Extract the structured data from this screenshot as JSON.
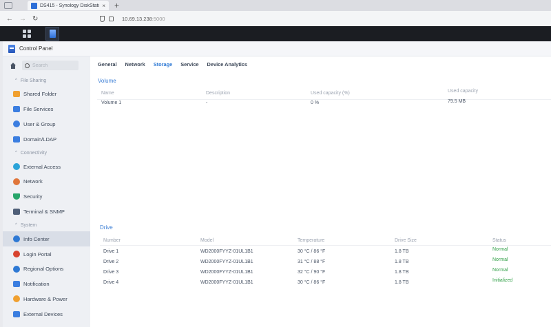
{
  "browser": {
    "tab_title": "DS415 - Synology DiskStation",
    "tab_close": "×",
    "new_tab": "+",
    "url_host": "10.69.13.238",
    "url_port": ":5000"
  },
  "window": {
    "title": "Control Panel"
  },
  "sidebar": {
    "search_placeholder": "Search",
    "groups": [
      {
        "label": "File Sharing",
        "items": [
          {
            "label": "Shared Folder",
            "icon": "folder-icon",
            "color": "#f0a030"
          },
          {
            "label": "File Services",
            "icon": "file-services-icon",
            "color": "#3b7ee0"
          },
          {
            "label": "User & Group",
            "icon": "users-icon",
            "color": "#3b7ee0"
          },
          {
            "label": "Domain/LDAP",
            "icon": "domain-icon",
            "color": "#3b7ee0"
          }
        ]
      },
      {
        "label": "Connectivity",
        "items": [
          {
            "label": "External Access",
            "icon": "external-access-icon",
            "color": "#2aa3d8"
          },
          {
            "label": "Network",
            "icon": "network-icon",
            "color": "#e0763b"
          },
          {
            "label": "Security",
            "icon": "security-icon",
            "color": "#27a56a"
          },
          {
            "label": "Terminal & SNMP",
            "icon": "terminal-icon",
            "color": "#4f5f78"
          }
        ]
      },
      {
        "label": "System",
        "items": [
          {
            "label": "Info Center",
            "icon": "info-icon",
            "color": "#2e79d4",
            "active": true
          },
          {
            "label": "Login Portal",
            "icon": "login-portal-icon",
            "color": "#d8432f"
          },
          {
            "label": "Regional Options",
            "icon": "globe-icon",
            "color": "#2e79d4"
          },
          {
            "label": "Notification",
            "icon": "notification-icon",
            "color": "#3b7ee0"
          },
          {
            "label": "Hardware & Power",
            "icon": "bulb-icon",
            "color": "#f0a030"
          },
          {
            "label": "External Devices",
            "icon": "external-devices-icon",
            "color": "#3b7ee0"
          }
        ]
      }
    ]
  },
  "tabs": [
    "General",
    "Network",
    "Storage",
    "Service",
    "Device Analytics"
  ],
  "active_tab": "Storage",
  "volume": {
    "title": "Volume",
    "columns": [
      "Name",
      "Description",
      "Used capacity (%)",
      "Used capacity"
    ],
    "rows": [
      [
        "Volume 1",
        "-",
        "0 %",
        "79.5 MB"
      ]
    ]
  },
  "drive": {
    "title": "Drive",
    "columns": [
      "Number",
      "Model",
      "Temperature",
      "Drive Size",
      "Status"
    ],
    "rows": [
      [
        "Drive 1",
        "WD2000FYYZ-01UL1B1",
        "30 °C / 86 °F",
        "1.8 TB",
        "Normal"
      ],
      [
        "Drive 2",
        "WD2000FYYZ-01UL1B1",
        "31 °C / 88 °F",
        "1.8 TB",
        "Normal"
      ],
      [
        "Drive 3",
        "WD2000FYYZ-01UL1B1",
        "32 °C / 90 °F",
        "1.8 TB",
        "Normal"
      ],
      [
        "Drive 4",
        "WD2000FYYZ-01UL1B1",
        "30 °C / 86 °F",
        "1.8 TB",
        "Initialized"
      ]
    ],
    "status_color": "#2f9f45"
  }
}
